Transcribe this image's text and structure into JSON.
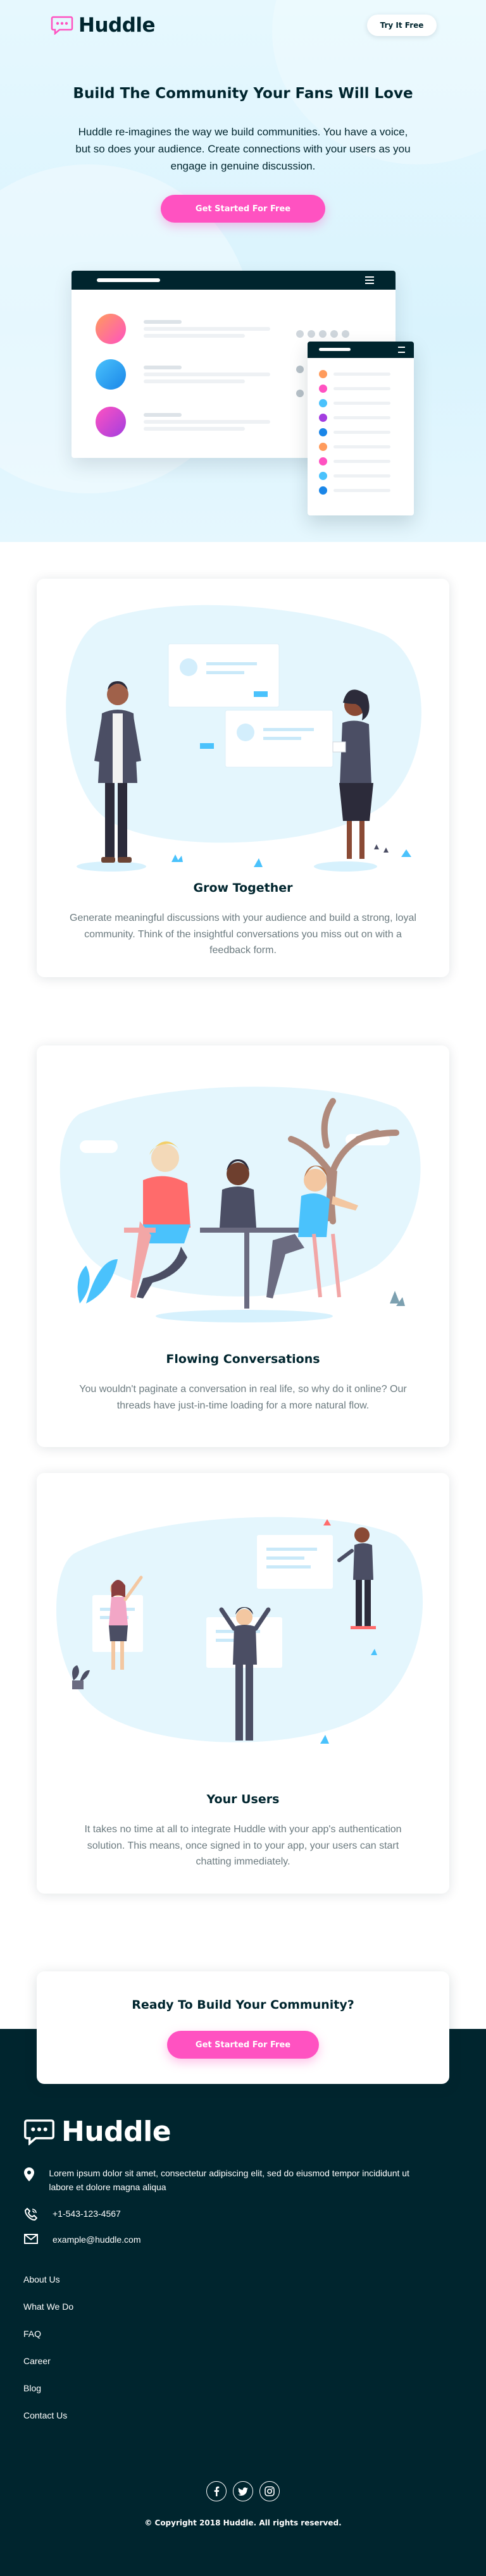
{
  "header": {
    "brand_name": "Huddle",
    "try_label": "Try It Free"
  },
  "hero": {
    "title": "Build The Community Your Fans Will Love",
    "text": "Huddle re-imagines the way we build communities. You have a voice, but so does your audience. Create connections with your users as you engage in genuine discussion.",
    "cta_label": "Get Started For Free"
  },
  "features": [
    {
      "title": "Grow Together",
      "text": "Generate meaningful discussions with your audience and build a strong, loyal community. Think of the insightful conversations you miss out on with a feedback form."
    },
    {
      "title": "Flowing Conversations",
      "text": "You wouldn't paginate a conversation in real life, so why do it online? Our threads have just-in-time loading for a more natural flow."
    },
    {
      "title": "Your Users",
      "text": "It takes no time at all to integrate Huddle with your app's authentication solution. This means, once signed in to your app, your users can start chatting immediately."
    }
  ],
  "cta_section": {
    "title": "Ready To Build Your Community?",
    "cta_label": "Get Started For Free"
  },
  "footer": {
    "brand_name": "Huddle",
    "address": "Lorem ipsum dolor sit amet, consectetur adipiscing elit, sed do eiusmod tempor incididunt ut labore et dolore magna aliqua",
    "phone": "+1-543-123-4567",
    "email": "example@huddle.com",
    "links": [
      "About Us",
      "What We Do",
      "FAQ",
      "Career",
      "Blog",
      "Contact Us"
    ],
    "socials": [
      "facebook-icon",
      "twitter-icon",
      "instagram-icon"
    ],
    "copyright": "© Copyright 2018 Huddle. All rights reserved."
  },
  "colors": {
    "accent": "#ff52c1",
    "dark": "#00252e",
    "hero_bg": "#e6f8fe",
    "light_blue": "#4ac2fc"
  }
}
